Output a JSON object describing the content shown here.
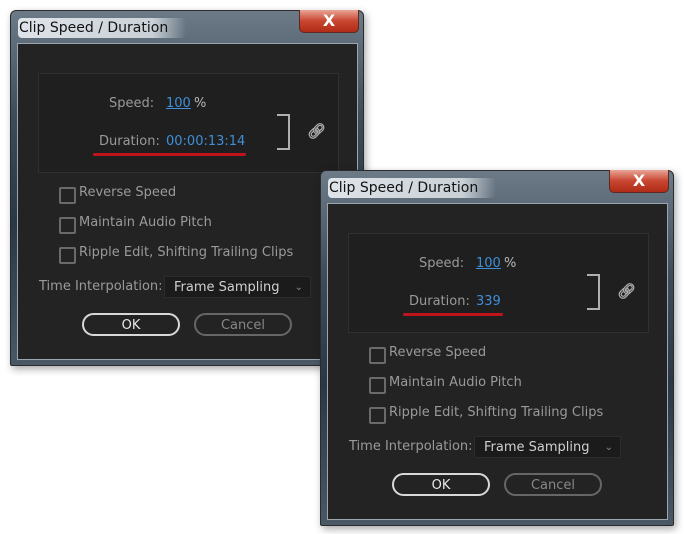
{
  "dialogs": [
    {
      "title": "Clip Speed / Duration",
      "close_label": "X",
      "speed_label": "Speed:",
      "speed_value": "100",
      "speed_unit": "%",
      "duration_label": "Duration:",
      "duration_value": "00:00:13:14",
      "checkboxes": [
        {
          "label": "Reverse Speed",
          "checked": false
        },
        {
          "label": "Maintain Audio Pitch",
          "checked": false
        },
        {
          "label": "Ripple Edit, Shifting Trailing Clips",
          "checked": false
        }
      ],
      "interp_label": "Time Interpolation:",
      "interp_value": "Frame Sampling",
      "ok_label": "OK",
      "cancel_label": "Cancel"
    },
    {
      "title": "Clip Speed / Duration",
      "close_label": "X",
      "speed_label": "Speed:",
      "speed_value": "100",
      "speed_unit": "%",
      "duration_label": "Duration:",
      "duration_value": "339",
      "checkboxes": [
        {
          "label": "Reverse Speed",
          "checked": false
        },
        {
          "label": "Maintain Audio Pitch",
          "checked": false
        },
        {
          "label": "Ripple Edit, Shifting Trailing Clips",
          "checked": false
        }
      ],
      "interp_label": "Time Interpolation:",
      "interp_value": "Frame Sampling",
      "ok_label": "OK",
      "cancel_label": "Cancel"
    }
  ],
  "colors": {
    "value_blue": "#3f8fd9",
    "highlight_red": "#c0141c",
    "panel_bg": "#232323"
  },
  "icons": {
    "close": "close-icon",
    "link": "link-icon",
    "dropdown": "chevron-down-icon"
  }
}
